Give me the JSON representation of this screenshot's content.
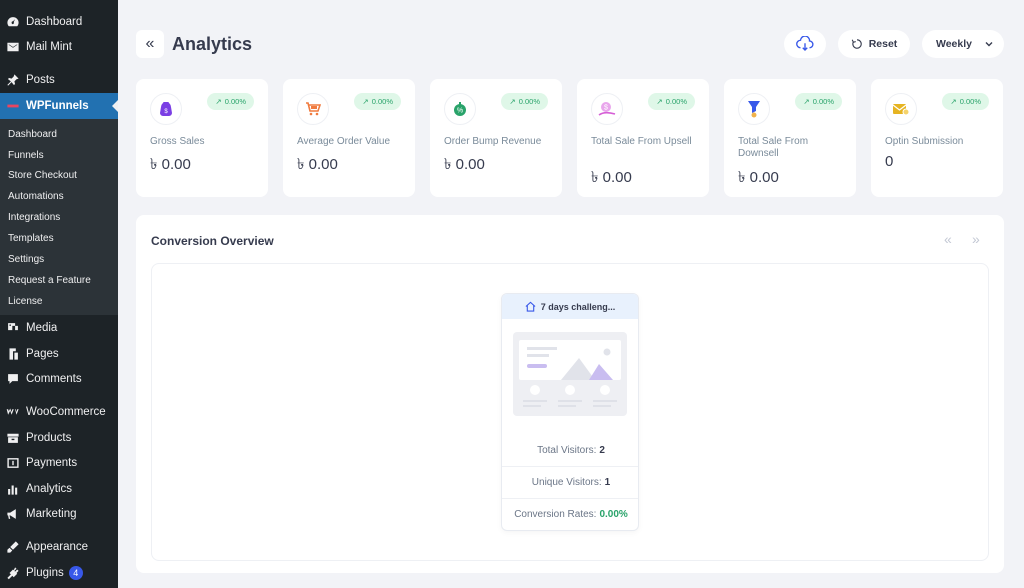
{
  "sidebar": {
    "top_items": [
      {
        "label": "Dashboard",
        "icon": "dashboard-icon"
      },
      {
        "label": "Mail Mint",
        "icon": "mail-icon"
      },
      {
        "label": "Posts",
        "icon": "pin-icon"
      },
      {
        "label": "WPFunnels",
        "icon": "wpfunnels-icon"
      }
    ],
    "submenu": [
      "Dashboard",
      "Funnels",
      "Store Checkout",
      "Automations",
      "Integrations",
      "Templates",
      "Settings",
      "Request a Feature",
      "License"
    ],
    "bottom_items": [
      {
        "label": "Media",
        "icon": "media-icon"
      },
      {
        "label": "Pages",
        "icon": "pages-icon"
      },
      {
        "label": "Comments",
        "icon": "comments-icon"
      },
      {
        "label": "WooCommerce",
        "icon": "woocommerce-icon"
      },
      {
        "label": "Products",
        "icon": "products-icon"
      },
      {
        "label": "Payments",
        "icon": "payments-icon"
      },
      {
        "label": "Analytics",
        "icon": "analytics-icon"
      },
      {
        "label": "Marketing",
        "icon": "marketing-icon"
      },
      {
        "label": "Appearance",
        "icon": "appearance-icon"
      },
      {
        "label": "Plugins",
        "icon": "plugins-icon",
        "badge": "4"
      }
    ]
  },
  "header": {
    "title": "Analytics",
    "reset_label": "Reset",
    "period_label": "Weekly"
  },
  "stats": [
    {
      "label": "Gross Sales",
      "value": "৳ 0.00",
      "change": "0.00%",
      "icon": "money-bag-icon",
      "color": "#7b3fe4"
    },
    {
      "label": "Average Order Value",
      "value": "৳ 0.00",
      "change": "0.00%",
      "icon": "cart-icon",
      "color": "#f07b3f"
    },
    {
      "label": "Order Bump Revenue",
      "value": "৳ 0.00",
      "change": "0.00%",
      "icon": "discount-icon",
      "color": "#29a36a"
    },
    {
      "label": "Total Sale From Upsell",
      "value": "৳ 0.00",
      "change": "0.00%",
      "icon": "upsell-icon",
      "color": "#d65fd6"
    },
    {
      "label": "Total Sale From Downsell",
      "value": "৳ 0.00",
      "change": "0.00%",
      "icon": "downsell-icon",
      "color": "#3858e9"
    },
    {
      "label": "Optin Submission",
      "value": "0",
      "change": "0.00%",
      "icon": "envelope-icon",
      "color": "#e6b422"
    }
  ],
  "conversion": {
    "title": "Conversion Overview",
    "funnel": {
      "name": "7 days challeng...",
      "total_visitors_label": "Total Visitors:",
      "total_visitors": "2",
      "unique_visitors_label": "Unique Visitors:",
      "unique_visitors": "1",
      "conversion_label": "Conversion Rates:",
      "conversion_rate": "0.00%"
    }
  }
}
